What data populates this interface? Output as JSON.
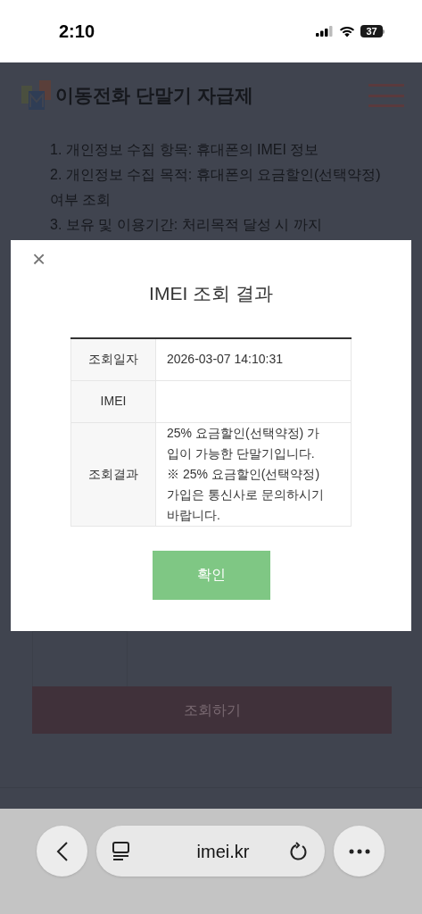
{
  "status_bar": {
    "time": "2:10",
    "battery": "37"
  },
  "page": {
    "site_title": "이동전화 단말기 자급제",
    "notice_lines": [
      "1. 개인정보 수집 항목: 휴대폰의 IMEI 정보",
      "2. 개인정보 수집 목적: 휴대폰의 요금할인(선택약정) 여부 조회",
      "3. 보유 및 이용기간: 처리목적 달성 시 까지"
    ],
    "submit_button": "조회하기"
  },
  "dialog": {
    "close": "×",
    "title": "IMEI 조회 결과",
    "rows": [
      {
        "label": "조회일자",
        "value": "2026-03-07 14:10:31"
      },
      {
        "label": "IMEI"
      },
      {
        "label": "조회결과",
        "value": "25% 요금할인(선택약정) 가입이 가능한 단말기입니다.\n※ 25% 요금할인(선택약정) 가입은 통신사로 문의하시기 바랍니다."
      }
    ],
    "confirm_button": "확인"
  },
  "browser": {
    "url": "imei.kr"
  }
}
